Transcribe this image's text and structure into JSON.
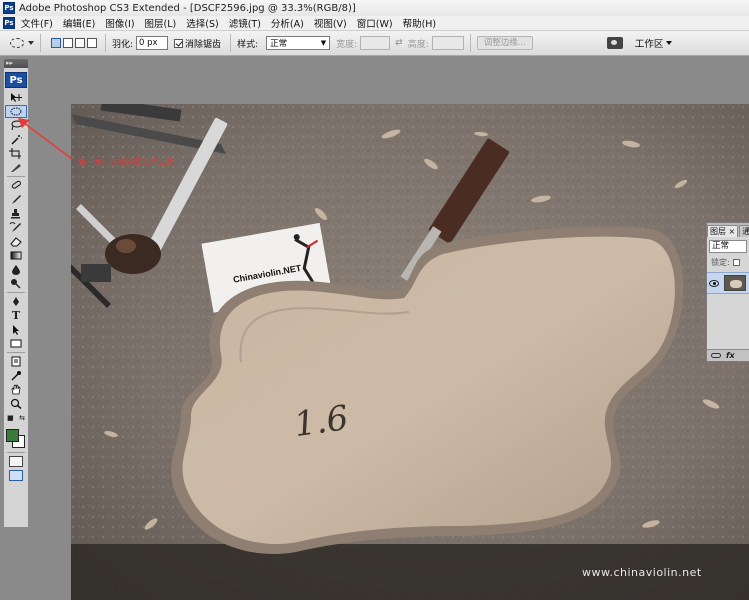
{
  "window": {
    "title": "Adobe Photoshop CS3 Extended - [DSCF2596.jpg @ 33.3%(RGB/8)]",
    "app_icon": "Ps"
  },
  "menu": [
    "文件(F)",
    "编辑(E)",
    "图像(I)",
    "图层(L)",
    "选择(S)",
    "滤镜(T)",
    "分析(A)",
    "视图(V)",
    "窗口(W)",
    "帮助(H)"
  ],
  "options": {
    "feather_label": "羽化:",
    "feather_value": "0 px",
    "antialias_label": "消除锯齿",
    "style_label": "样式:",
    "style_value": "正常",
    "width_label": "宽度:",
    "height_label": "高度:",
    "refine_edge": "调整边缘...",
    "workspace_label": "工作区"
  },
  "toolbox": {
    "logo": "Ps",
    "type_tool": "T",
    "fg_color": "#3a7a3a",
    "bg_color": "#ffffff"
  },
  "annotation": {
    "text": "第一步：选择椭圆选框工具",
    "color": "#e83a3a"
  },
  "document": {
    "business_card_text": "Chinaviolin.NET",
    "pencil_mark": "1.6",
    "watermark": "www.chinaviolin.net"
  },
  "layers_panel": {
    "tab_layers": "图层",
    "tab_close": "×",
    "tab_second": "通",
    "blend_mode": "正常",
    "lock_label": "锁定:",
    "footer_fx": "fx"
  }
}
